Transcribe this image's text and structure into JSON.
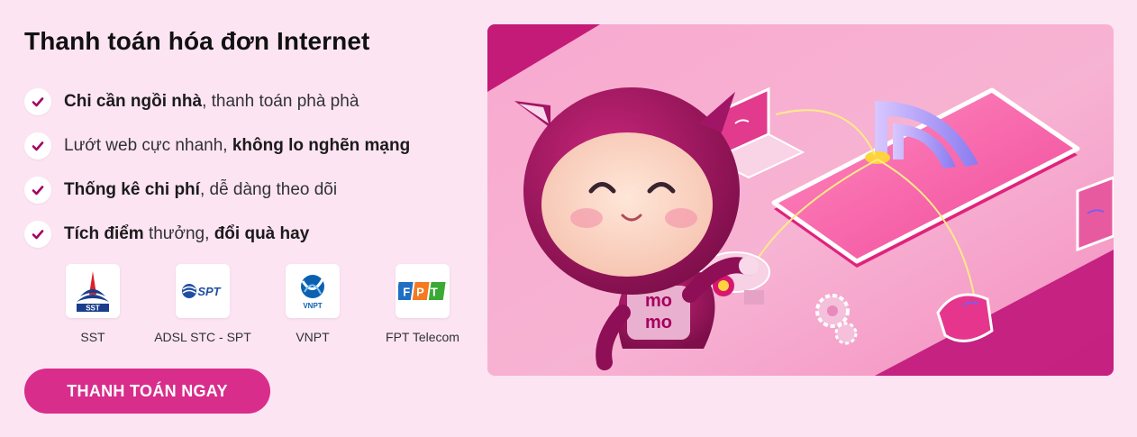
{
  "title": "Thanh toán hóa đơn Internet",
  "features": [
    {
      "bold": "Chi cần ngồi nhà",
      "rest": ", thanh toán phà phà"
    },
    {
      "plain": "Lướt web cực nhanh, ",
      "bold": "không lo nghẽn mạng"
    },
    {
      "bold": "Thống kê chi phí",
      "rest": ", dễ dàng theo dõi"
    },
    {
      "bold": "Tích điểm",
      "mid": " thưởng, ",
      "bold2": "đổi quà hay"
    }
  ],
  "providers": [
    {
      "name": "SST",
      "logo_text": "SST"
    },
    {
      "name": "ADSL STC - SPT",
      "logo_text": "SPT"
    },
    {
      "name": "VNPT",
      "logo_text": "VNPT"
    },
    {
      "name": "FPT Telecom",
      "logo_text": "FPT"
    }
  ],
  "cta_label": "THANH TOÁN NGAY",
  "hero": {
    "mascot_text_1": "mo",
    "mascot_text_2": "mo"
  },
  "colors": {
    "accent": "#d82d8b",
    "page_bg": "#fde4f3",
    "check": "#a50064"
  }
}
